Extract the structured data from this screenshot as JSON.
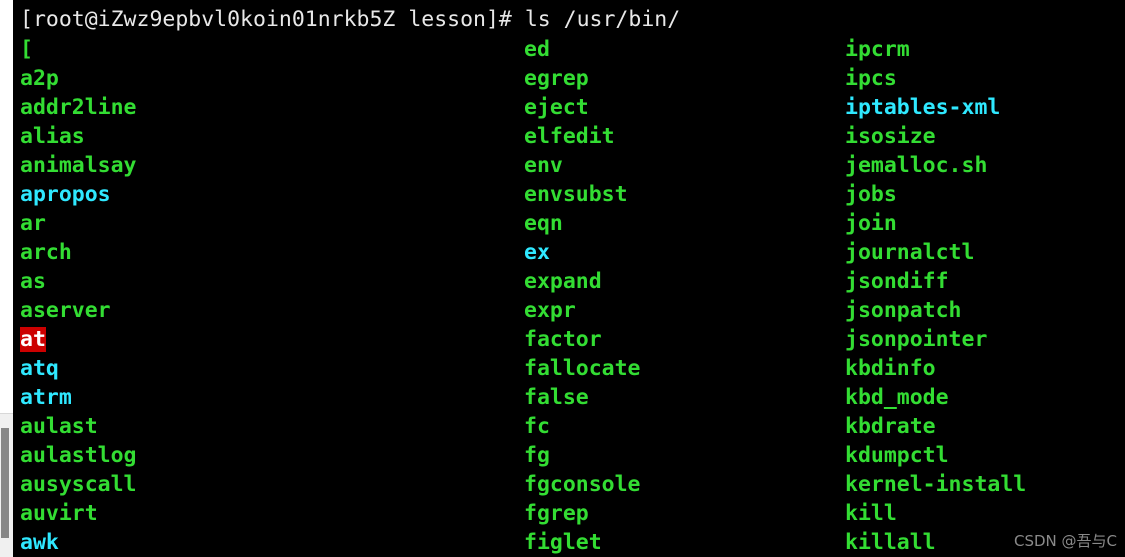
{
  "terminal": {
    "prompt": "[root@iZwz9epbvl0koin01nrkb5Z lesson]# ls /usr/bin/",
    "user": "root",
    "hostname": "iZwz9epbvl0koin01nrkb5Z",
    "cwd": "lesson",
    "prompt_symbol": "#",
    "command": "ls /usr/bin/",
    "colors": {
      "background": "#000000",
      "foreground": "#e8e8e8",
      "executable": "#33dd33",
      "symlink": "#2fe8ff",
      "setuid_fg": "#ffffff",
      "setuid_bg": "#cc0000"
    },
    "columns": [
      {
        "name": "column-1",
        "entries": [
          {
            "text": "[",
            "kind": "executable"
          },
          {
            "text": "a2p",
            "kind": "executable"
          },
          {
            "text": "addr2line",
            "kind": "executable"
          },
          {
            "text": "alias",
            "kind": "executable"
          },
          {
            "text": "animalsay",
            "kind": "executable"
          },
          {
            "text": "apropos",
            "kind": "symlink"
          },
          {
            "text": "ar",
            "kind": "executable"
          },
          {
            "text": "arch",
            "kind": "executable"
          },
          {
            "text": "as",
            "kind": "executable"
          },
          {
            "text": "aserver",
            "kind": "executable"
          },
          {
            "text": "at",
            "kind": "setuid"
          },
          {
            "text": "atq",
            "kind": "symlink"
          },
          {
            "text": "atrm",
            "kind": "symlink"
          },
          {
            "text": "aulast",
            "kind": "executable"
          },
          {
            "text": "aulastlog",
            "kind": "executable"
          },
          {
            "text": "ausyscall",
            "kind": "executable"
          },
          {
            "text": "auvirt",
            "kind": "executable"
          },
          {
            "text": "awk",
            "kind": "symlink"
          }
        ]
      },
      {
        "name": "column-2",
        "entries": [
          {
            "text": "ed",
            "kind": "executable"
          },
          {
            "text": "egrep",
            "kind": "executable"
          },
          {
            "text": "eject",
            "kind": "executable"
          },
          {
            "text": "elfedit",
            "kind": "executable"
          },
          {
            "text": "env",
            "kind": "executable"
          },
          {
            "text": "envsubst",
            "kind": "executable"
          },
          {
            "text": "eqn",
            "kind": "executable"
          },
          {
            "text": "ex",
            "kind": "symlink"
          },
          {
            "text": "expand",
            "kind": "executable"
          },
          {
            "text": "expr",
            "kind": "executable"
          },
          {
            "text": "factor",
            "kind": "executable"
          },
          {
            "text": "fallocate",
            "kind": "executable"
          },
          {
            "text": "false",
            "kind": "executable"
          },
          {
            "text": "fc",
            "kind": "executable"
          },
          {
            "text": "fg",
            "kind": "executable"
          },
          {
            "text": "fgconsole",
            "kind": "executable"
          },
          {
            "text": "fgrep",
            "kind": "executable"
          },
          {
            "text": "figlet",
            "kind": "executable"
          }
        ]
      },
      {
        "name": "column-3",
        "entries": [
          {
            "text": "ipcrm",
            "kind": "executable"
          },
          {
            "text": "ipcs",
            "kind": "executable"
          },
          {
            "text": "iptables-xml",
            "kind": "symlink"
          },
          {
            "text": "isosize",
            "kind": "executable"
          },
          {
            "text": "jemalloc.sh",
            "kind": "executable"
          },
          {
            "text": "jobs",
            "kind": "executable"
          },
          {
            "text": "join",
            "kind": "executable"
          },
          {
            "text": "journalctl",
            "kind": "executable"
          },
          {
            "text": "jsondiff",
            "kind": "executable"
          },
          {
            "text": "jsonpatch",
            "kind": "executable"
          },
          {
            "text": "jsonpointer",
            "kind": "executable"
          },
          {
            "text": "kbdinfo",
            "kind": "executable"
          },
          {
            "text": "kbd_mode",
            "kind": "executable"
          },
          {
            "text": "kbdrate",
            "kind": "executable"
          },
          {
            "text": "kdumpctl",
            "kind": "executable"
          },
          {
            "text": "kernel-install",
            "kind": "executable"
          },
          {
            "text": "kill",
            "kind": "executable"
          },
          {
            "text": "killall",
            "kind": "executable"
          }
        ]
      }
    ]
  },
  "watermark": {
    "text": "CSDN @吾与C"
  }
}
